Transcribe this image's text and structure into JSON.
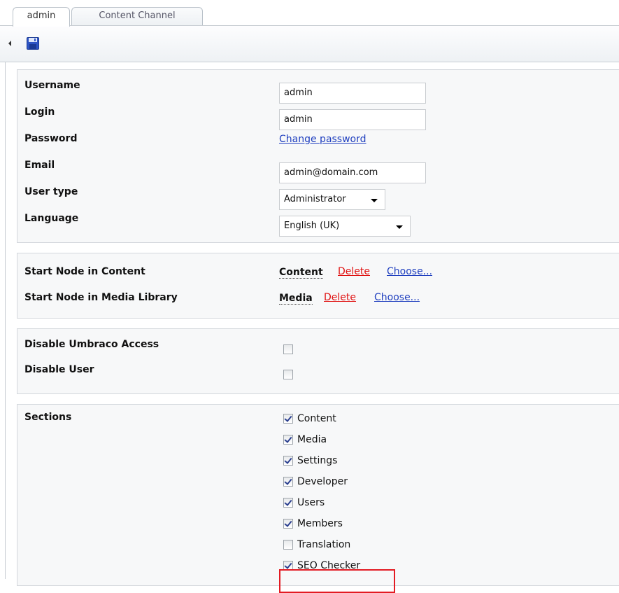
{
  "tabs": [
    {
      "label": "admin",
      "active": true
    },
    {
      "label": "Content Channel",
      "active": false
    }
  ],
  "toolbar": {
    "back_icon": "caret-left-icon",
    "save_icon": "floppy-disk-icon"
  },
  "user_form": {
    "username_label": "Username",
    "username_value": "admin",
    "login_label": "Login",
    "login_value": "admin",
    "password_label": "Password",
    "password_link": "Change password",
    "email_label": "Email",
    "email_value": "admin@domain.com",
    "usertype_label": "User type",
    "usertype_value": "Administrator",
    "language_label": "Language",
    "language_value": "English (UK)"
  },
  "start_nodes": {
    "content_label": "Start Node in Content",
    "content_node": "Content",
    "media_label": "Start Node in Media Library",
    "media_node": "Media",
    "delete_label": "Delete",
    "choose_label": "Choose..."
  },
  "access": {
    "disable_umbraco_label": "Disable Umbraco Access",
    "disable_umbraco_checked": false,
    "disable_user_label": "Disable User",
    "disable_user_checked": false
  },
  "sections": {
    "label": "Sections",
    "items": [
      {
        "label": "Content",
        "checked": true
      },
      {
        "label": "Media",
        "checked": true
      },
      {
        "label": "Settings",
        "checked": true
      },
      {
        "label": "Developer",
        "checked": true
      },
      {
        "label": "Users",
        "checked": true
      },
      {
        "label": "Members",
        "checked": true
      },
      {
        "label": "Translation",
        "checked": false
      },
      {
        "label": "SEO Checker",
        "checked": true
      }
    ]
  },
  "colors": {
    "highlight": "#e31b23",
    "link": "#1f3fbf",
    "delete_link": "#e01010"
  }
}
